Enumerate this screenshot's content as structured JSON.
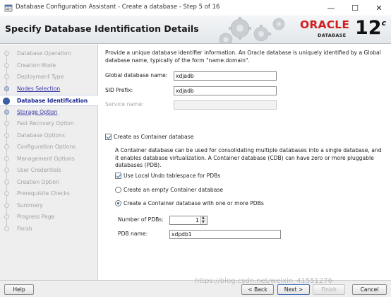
{
  "window": {
    "title": "Database Configuration Assistant - Create a database - Step 5 of 16",
    "minimize_glyph": "—",
    "maximize_glyph": "☐",
    "close_glyph": "✕"
  },
  "header": {
    "heading": "Specify Database Identification Details",
    "brand_oracle": "ORACLE",
    "brand_database": "DATABASE",
    "version": "12",
    "version_suffix": "c"
  },
  "steps": [
    {
      "label": "Database Operation",
      "state": "disabled"
    },
    {
      "label": "Creation Mode",
      "state": "disabled"
    },
    {
      "label": "Deployment Type",
      "state": "disabled"
    },
    {
      "label": "Nodes Selection",
      "state": "link"
    },
    {
      "label": "Database Identification",
      "state": "current"
    },
    {
      "label": "Storage Option",
      "state": "link"
    },
    {
      "label": "Fast Recovery Option",
      "state": "disabled"
    },
    {
      "label": "Database Options",
      "state": "disabled"
    },
    {
      "label": "Configuration Options",
      "state": "disabled"
    },
    {
      "label": "Management Options",
      "state": "disabled"
    },
    {
      "label": "User Credentials",
      "state": "disabled"
    },
    {
      "label": "Creation Option",
      "state": "disabled"
    },
    {
      "label": "Prerequisite Checks",
      "state": "disabled"
    },
    {
      "label": "Summary",
      "state": "disabled"
    },
    {
      "label": "Progress Page",
      "state": "disabled"
    },
    {
      "label": "Finish",
      "state": "disabled"
    }
  ],
  "form": {
    "intro": "Provide a unique database identifier information. An Oracle database is uniquely identified by a Global database name, typically of the form \"name.domain\".",
    "global_name_label": "Global database name:",
    "global_name_value": "xdjadb",
    "sid_label": "SID Prefix:",
    "sid_value": "xdjadb",
    "service_label": "Service name:",
    "service_value": "",
    "container_label": "Create as Container database",
    "container_checked": true,
    "container_desc": "A Container database can be used for consolidating multiple databases into a single database, and it enables database virtualization. A Container database (CDB) can have zero or more pluggable databases (PDB).",
    "local_undo_label": "Use Local Undo tablespace for PDBs",
    "local_undo_checked": true,
    "empty_container_label": "Create an empty Container database",
    "with_pdbs_label": "Create a Container database with one or more PDBs",
    "selected_option": "with_pdbs",
    "num_pdbs_label": "Number of PDBs:",
    "num_pdbs_value": "1",
    "pdb_name_label": "PDB name:",
    "pdb_name_value": "xdpdb1"
  },
  "buttons": {
    "help": "Help",
    "back": "< Back",
    "next": "Next >",
    "finish": "Finish",
    "cancel": "Cancel"
  },
  "watermark": "https://blog.csdn.net/weixin_41551276"
}
